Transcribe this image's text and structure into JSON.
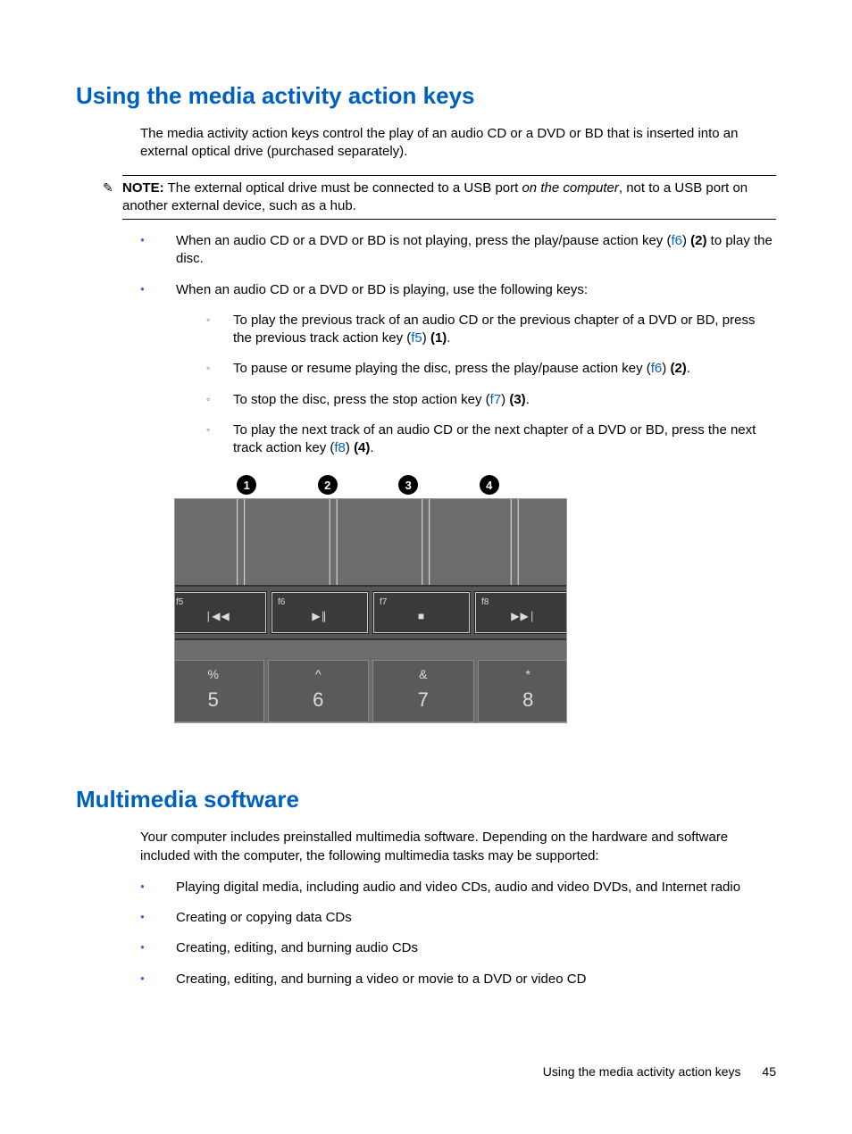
{
  "section1": {
    "heading": "Using the media activity action keys",
    "intro": "The media activity action keys control the play of an audio CD or a DVD or BD that is inserted into an external optical drive (purchased separately).",
    "note_label": "NOTE:",
    "note_pre": "The external optical drive must be connected to a USB port ",
    "note_em": "on the computer",
    "note_post": ", not to a USB port on another external device, such as a hub.",
    "b1_pre": "When an audio CD or a DVD or BD is not playing, press the play/pause action key (",
    "b1_key": "f6",
    "b1_mid": ") ",
    "b1_bold": "(2)",
    "b1_post": " to play the disc.",
    "b2": "When an audio CD or a DVD or BD is playing, use the following keys:",
    "sb1_pre": "To play the previous track of an audio CD or the previous chapter of a DVD or BD, press the previous track action key (",
    "sb1_key": "f5",
    "sb1_mid": ") ",
    "sb1_bold": "(1)",
    "sb1_post": ".",
    "sb2_pre": "To pause or resume playing the disc, press the play/pause action key (",
    "sb2_key": "f6",
    "sb2_mid": ") ",
    "sb2_bold": "(2)",
    "sb2_post": ".",
    "sb3_pre": "To stop the disc, press the stop action key (",
    "sb3_key": "f7",
    "sb3_mid": ") ",
    "sb3_bold": "(3)",
    "sb3_post": ".",
    "sb4_pre": "To play the next track of an audio CD or the next chapter of a DVD or BD, press the next track action key (",
    "sb4_key": "f8",
    "sb4_mid": ") ",
    "sb4_bold": "(4)",
    "sb4_post": "."
  },
  "diagram": {
    "callouts": [
      "1",
      "2",
      "3",
      "4"
    ],
    "fkeys": [
      {
        "label": "f5",
        "symbol": "∣◀◀"
      },
      {
        "label": "f6",
        "symbol": "▶∥"
      },
      {
        "label": "f7",
        "symbol": "■"
      },
      {
        "label": "f8",
        "symbol": "▶▶∣"
      }
    ],
    "numkeys": [
      {
        "top": "%",
        "bot": "5"
      },
      {
        "top": "^",
        "bot": "6"
      },
      {
        "top": "&",
        "bot": "7"
      },
      {
        "top": "*",
        "bot": "8"
      }
    ]
  },
  "section2": {
    "heading": "Multimedia software",
    "intro": "Your computer includes preinstalled multimedia software. Depending on the hardware and software included with the computer, the following multimedia tasks may be supported:",
    "items": [
      "Playing digital media, including audio and video CDs, audio and video DVDs, and Internet radio",
      "Creating or copying data CDs",
      "Creating, editing, and burning audio CDs",
      "Creating, editing, and burning a video or movie to a DVD or video CD"
    ]
  },
  "footer": {
    "text": "Using the media activity action keys",
    "page": "45"
  }
}
